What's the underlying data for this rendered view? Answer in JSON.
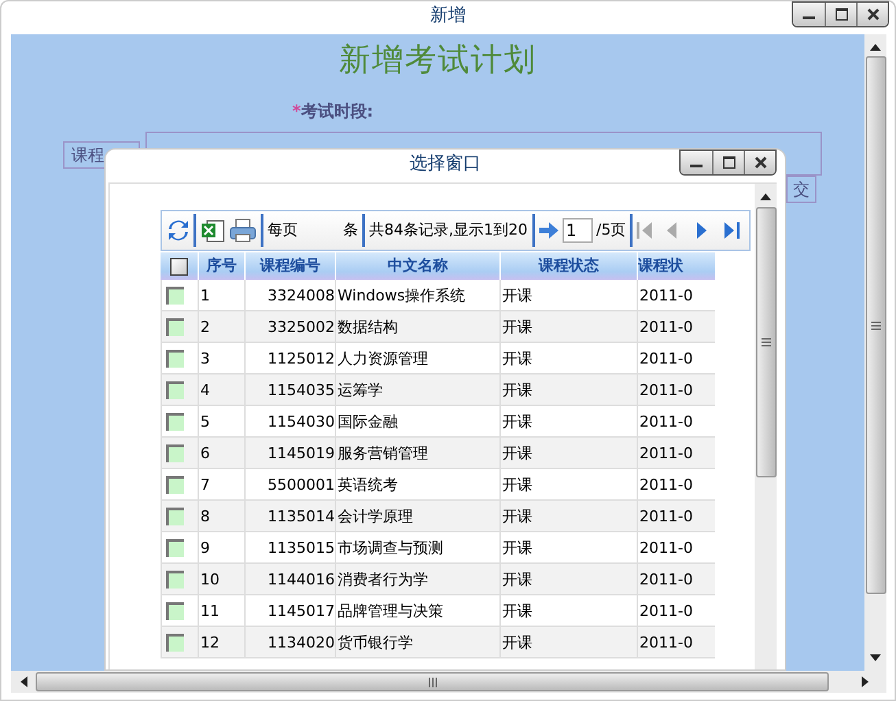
{
  "window": {
    "title": "新增"
  },
  "form": {
    "heading": "新增考试计划",
    "required_mark": "*",
    "field_label": "考试时段:",
    "course_button": "课程",
    "submit_button": "交"
  },
  "dialog": {
    "title": "选择窗口",
    "toolbar": {
      "per_page_label": "每页",
      "per_page_unit": "条",
      "summary": "共84条记录,显示1到20",
      "page_input": "1",
      "page_total": "/5页"
    },
    "header_checked": false,
    "columns": [
      "序号",
      "课程编号",
      "中文名称",
      "课程状态",
      "课程状"
    ],
    "rows": [
      {
        "no": "1",
        "code": "3324008",
        "name": "Windows操作系统",
        "status": "开课",
        "date": "2011-0",
        "checked": false
      },
      {
        "no": "2",
        "code": "3325002",
        "name": "数据结构",
        "status": "开课",
        "date": "2011-0",
        "checked": false
      },
      {
        "no": "3",
        "code": "1125012",
        "name": "人力资源管理",
        "status": "开课",
        "date": "2011-0",
        "checked": false
      },
      {
        "no": "4",
        "code": "1154035",
        "name": "运筹学",
        "status": "开课",
        "date": "2011-0",
        "checked": false
      },
      {
        "no": "5",
        "code": "1154030",
        "name": "国际金融",
        "status": "开课",
        "date": "2011-0",
        "checked": false
      },
      {
        "no": "6",
        "code": "1145019",
        "name": "服务营销管理",
        "status": "开课",
        "date": "2011-0",
        "checked": false
      },
      {
        "no": "7",
        "code": "5500001",
        "name": "英语统考",
        "status": "开课",
        "date": "2011-0",
        "checked": false
      },
      {
        "no": "8",
        "code": "1135014",
        "name": "会计学原理",
        "status": "开课",
        "date": "2011-0",
        "checked": false
      },
      {
        "no": "9",
        "code": "1135015",
        "name": "市场调查与预测",
        "status": "开课",
        "date": "2011-0",
        "checked": false
      },
      {
        "no": "10",
        "code": "1144016",
        "name": "消费者行为学",
        "status": "开课",
        "date": "2011-0",
        "checked": false
      },
      {
        "no": "11",
        "code": "1145017",
        "name": "品牌管理与决策",
        "status": "开课",
        "date": "2011-0",
        "checked": false
      },
      {
        "no": "12",
        "code": "1134020",
        "name": "货币银行学",
        "status": "开课",
        "date": "2011-0",
        "checked": false
      }
    ]
  }
}
